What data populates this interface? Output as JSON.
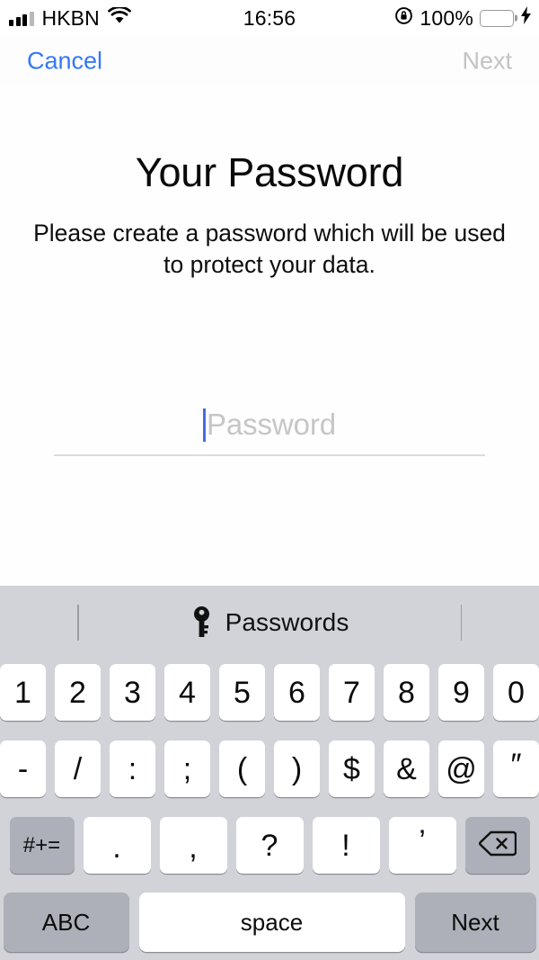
{
  "status_bar": {
    "carrier": "HKBN",
    "wifi_icon": "wifi-icon",
    "signal_icon": "cellular-signal-icon",
    "time": "16:56",
    "rotation_lock_icon": "rotation-lock-icon",
    "battery_percent": "100%",
    "battery_icon": "battery-icon",
    "charging_icon": "lightning-bolt-icon",
    "battery_color": "#6fd07e",
    "battery_level": 100
  },
  "nav_bar": {
    "cancel_label": "Cancel",
    "next_label": "Next",
    "cancel_color": "#3478f6",
    "next_color": "#c3c3c5"
  },
  "content": {
    "title": "Your Password",
    "subtitle": "Please create a password which will be used to protect your data.",
    "password_field": {
      "value": "",
      "placeholder": "Password",
      "caret_color": "#4869e8",
      "placeholder_color": "#c6c6c8"
    }
  },
  "keyboard": {
    "background_color": "#d1d3d9",
    "toolbar": {
      "key_icon": "key-icon",
      "autofill_label": "Passwords"
    },
    "row1": [
      "1",
      "2",
      "3",
      "4",
      "5",
      "6",
      "7",
      "8",
      "9",
      "0"
    ],
    "row2": [
      "-",
      "/",
      ":",
      ";",
      "(",
      ")",
      "$",
      "&",
      "@",
      "″"
    ],
    "row3": {
      "symbols_toggle": "#+=",
      "chars": [
        ".",
        ",",
        "?",
        "!",
        "’"
      ],
      "backspace_icon": "backspace-icon"
    },
    "row4": {
      "abc_label": "ABC",
      "space_label": "space",
      "return_label": "Next"
    }
  }
}
